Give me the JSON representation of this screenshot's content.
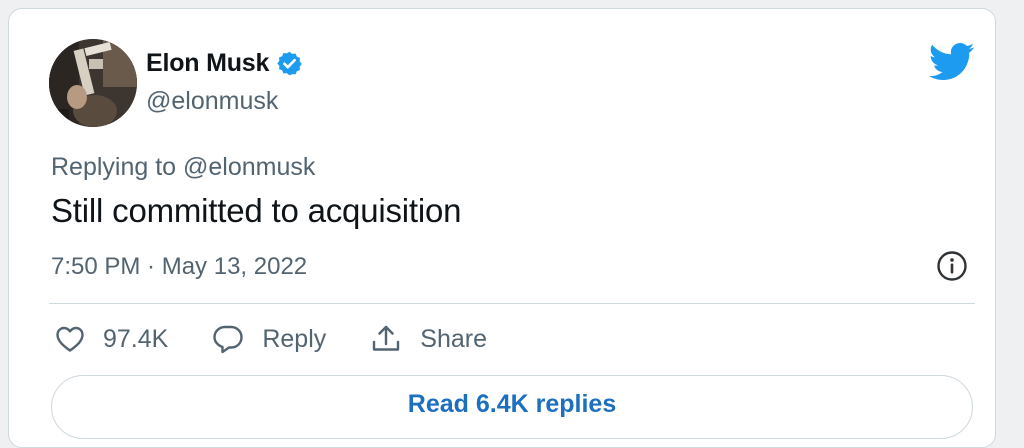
{
  "author": {
    "name": "Elon Musk",
    "handle": "@elonmusk",
    "verified": true
  },
  "tweet": {
    "replying_to": "Replying to @elonmusk",
    "text": "Still committed to acquisition",
    "timestamp": "7:50 PM · May 13, 2022"
  },
  "actions": {
    "likes": "97.4K",
    "reply_label": "Reply",
    "share_label": "Share"
  },
  "read_replies": "Read 6.4K replies",
  "icons": [
    "verified-badge-icon",
    "twitter-bird-icon",
    "info-icon",
    "heart-icon",
    "reply-bubble-icon",
    "share-icon"
  ],
  "colors": {
    "brand_blue": "#1d9bf0",
    "link_blue": "#1d6fbf",
    "secondary_text": "#536471",
    "border": "#cfd9de"
  }
}
